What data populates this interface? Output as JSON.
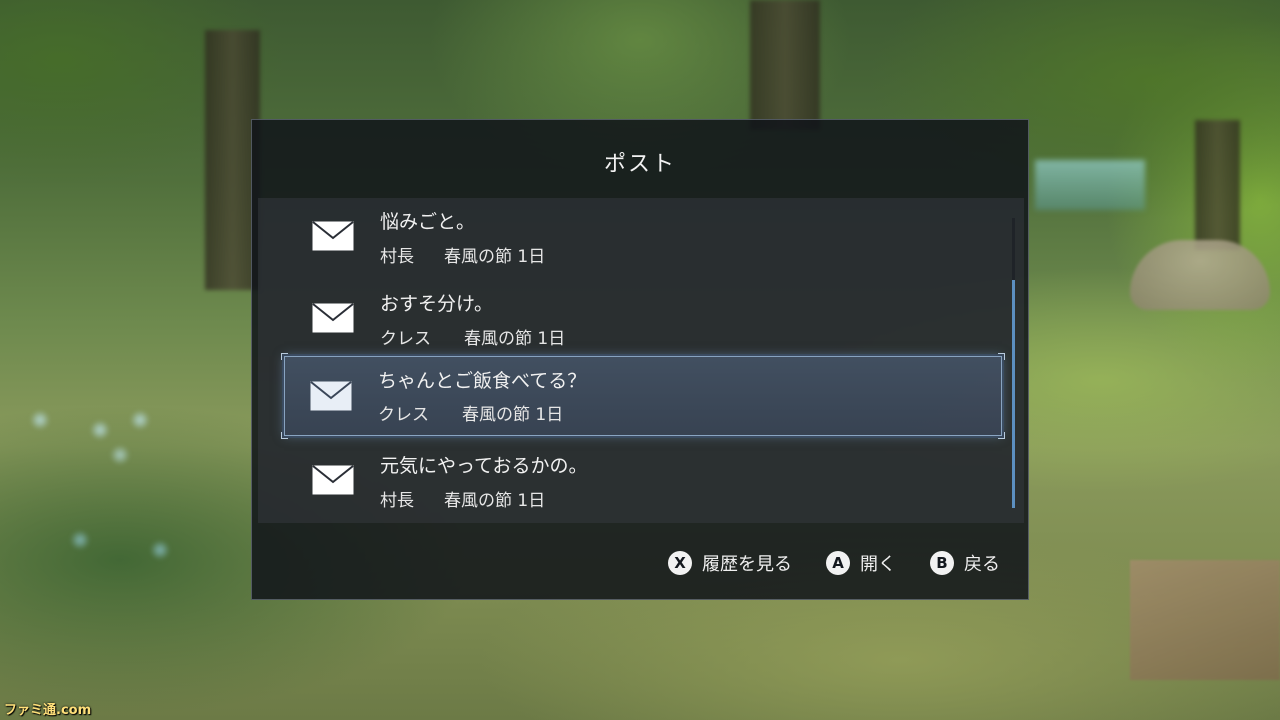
{
  "title": "ポスト",
  "mails": [
    {
      "subject": "悩みごと。",
      "sender": "村長",
      "date": "春風の節 1日",
      "selected": false
    },
    {
      "subject": "おすそ分け。",
      "sender": "クレス",
      "date": "春風の節 1日",
      "selected": false
    },
    {
      "subject": "ちゃんとご飯食べてる？",
      "sender": "クレス",
      "date": "春風の節 1日",
      "selected": true
    },
    {
      "subject": "元気にやっておるかの。",
      "sender": "村長",
      "date": "春風の節 1日",
      "selected": false
    }
  ],
  "footer": {
    "history": {
      "button": "X",
      "label": "履歴を見る"
    },
    "open": {
      "button": "A",
      "label": "開く"
    },
    "back": {
      "button": "B",
      "label": "戻る"
    }
  },
  "watermark": "ファミ通.com",
  "colors": {
    "accent": "#5c8fc0",
    "panel": "#10141a"
  },
  "icons": {
    "mail": "envelope-icon"
  }
}
